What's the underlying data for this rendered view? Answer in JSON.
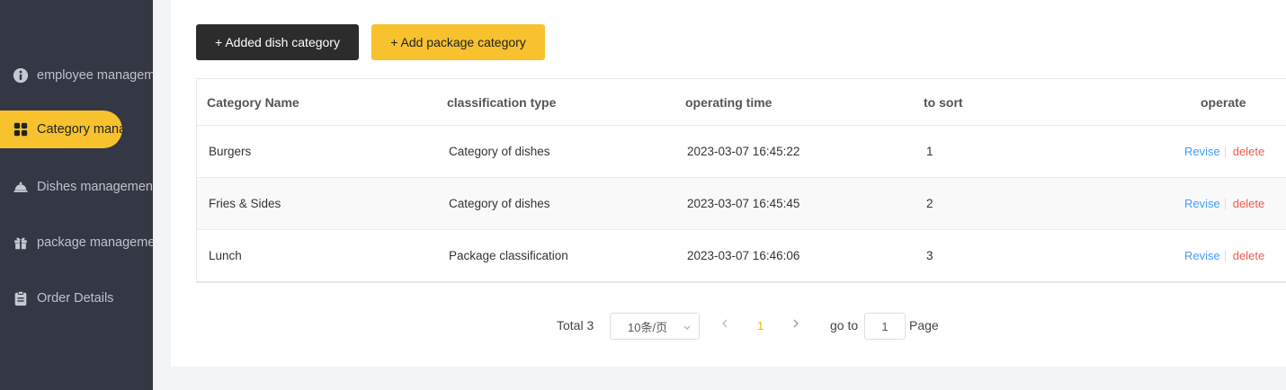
{
  "sidebar": {
    "items": [
      {
        "label": "employee management",
        "icon": "info-circle-icon",
        "active": false
      },
      {
        "label": "Category management",
        "icon": "grid-icon",
        "active": true
      },
      {
        "label": "Dishes management",
        "icon": "dish-cloche-icon",
        "active": false
      },
      {
        "label": "package management",
        "icon": "gift-icon",
        "active": false
      },
      {
        "label": "Order Details",
        "icon": "clipboard-icon",
        "active": false
      }
    ]
  },
  "toolbar": {
    "add_dish_category": "+ Added dish category",
    "add_package_category": "+ Add package category"
  },
  "table": {
    "headers": [
      "Category Name",
      "classification type",
      "operating time",
      "to sort",
      "operate"
    ],
    "rows": [
      {
        "name": "Burgers",
        "type": "Category of dishes",
        "time": "2023-03-07 16:45:22",
        "sort": "1",
        "revise": "Revise",
        "delete": "delete"
      },
      {
        "name": "Fries & Sides",
        "type": "Category of dishes",
        "time": "2023-03-07 16:45:45",
        "sort": "2",
        "revise": "Revise",
        "delete": "delete"
      },
      {
        "name": "Lunch",
        "type": "Package classification",
        "time": "2023-03-07 16:46:06",
        "sort": "3",
        "revise": "Revise",
        "delete": "delete"
      }
    ]
  },
  "pagination": {
    "total": "Total 3",
    "page_size": "10条/页",
    "current_page": "1",
    "goto_label": "go to",
    "goto_value": "1",
    "page_label": "Page"
  },
  "colors": {
    "sidebar_bg": "#343744",
    "accent": "#f7c22d",
    "dark_button": "#2c2c2c",
    "link_blue": "#419eff",
    "delete_red": "#f05a4e"
  }
}
